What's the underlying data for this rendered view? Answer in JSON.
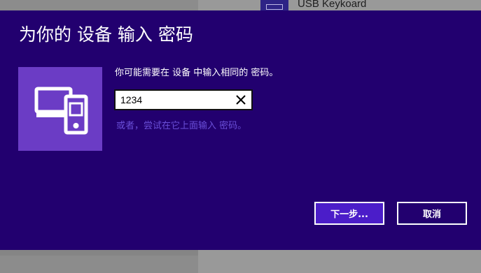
{
  "dialog": {
    "title": "为你的 设备 输入 密码",
    "instruction": "你可能需要在 设备 中输入相同的 密码。",
    "pin_value": "1234",
    "alt_instruction": "或者，尝试在它上面输入 密码。",
    "next_label": "下一步...",
    "cancel_label": "取消",
    "tile_color": "#6b3cc5",
    "background_color": "#22006f",
    "accent_color": "#4b1dc9",
    "tile_icon": "devices-icon"
  },
  "background": {
    "device_label": "USB Keykoard",
    "device_icon": "keyboard-icon"
  }
}
